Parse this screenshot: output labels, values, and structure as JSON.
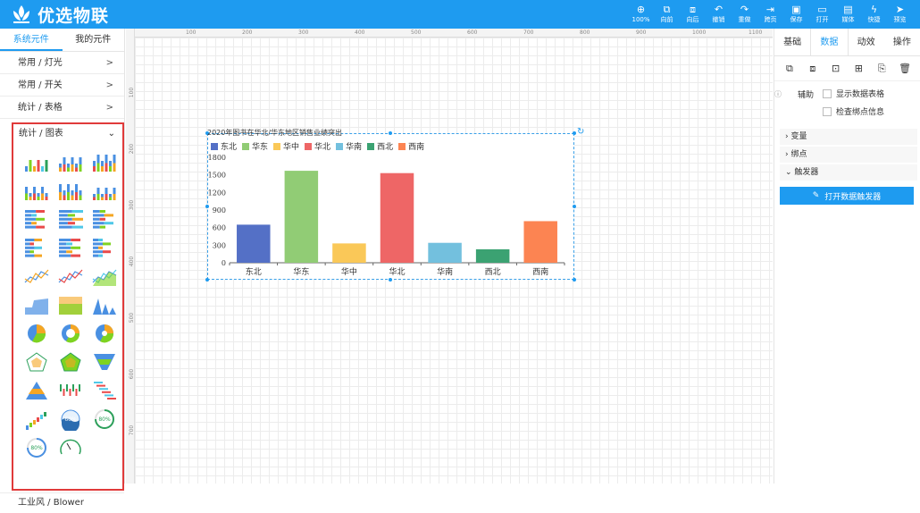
{
  "app": {
    "title": "优选物联"
  },
  "toolbar": {
    "items": [
      {
        "label": "100%",
        "icon": "zoom-icon"
      },
      {
        "label": "向前",
        "icon": "bring-forward-icon"
      },
      {
        "label": "向后",
        "icon": "send-backward-icon"
      },
      {
        "label": "撤销",
        "icon": "undo-icon"
      },
      {
        "label": "重做",
        "icon": "redo-icon"
      },
      {
        "label": "跨页",
        "icon": "cross-page-icon"
      },
      {
        "label": "保存",
        "icon": "save-icon"
      },
      {
        "label": "打开",
        "icon": "open-folder-icon"
      },
      {
        "label": "媒体",
        "icon": "media-icon"
      },
      {
        "label": "快捷",
        "icon": "lightning-icon"
      },
      {
        "label": "预览",
        "icon": "send-icon"
      }
    ]
  },
  "left": {
    "tabs": [
      {
        "label": "系统元件"
      },
      {
        "label": "我的元件"
      }
    ],
    "categories": [
      {
        "label": "常用 / 灯光"
      },
      {
        "label": "常用 / 开关"
      },
      {
        "label": "统计 / 表格"
      }
    ],
    "expanded": {
      "label": "统计 / 图表"
    },
    "gauge_labels": [
      "60%",
      "80%",
      "80%"
    ],
    "footer": {
      "label": "工业风 / Blower"
    }
  },
  "ruler": {
    "h_ticks": [
      "100",
      "200",
      "300",
      "400",
      "500",
      "600",
      "700",
      "800",
      "900",
      "1000",
      "1100"
    ],
    "v_ticks": [
      "100",
      "200",
      "300",
      "400",
      "500",
      "600",
      "700"
    ]
  },
  "chart_data": {
    "type": "bar",
    "title": "2020年图书在华北/华东地区销售业绩突出",
    "categories": [
      "东北",
      "华东",
      "华中",
      "华北",
      "华南",
      "西北",
      "西南"
    ],
    "values": [
      650,
      1570,
      330,
      1530,
      340,
      230,
      710
    ],
    "colors": [
      "#5470c6",
      "#91cc75",
      "#fac858",
      "#ee6666",
      "#73c0de",
      "#3ba272",
      "#fc8452"
    ],
    "legend": [
      "东北",
      "华东",
      "华中",
      "华北",
      "华南",
      "西北",
      "西南"
    ],
    "yticks": [
      "0",
      "300",
      "600",
      "900",
      "1200",
      "1500",
      "1800"
    ],
    "ylim": [
      0,
      1800
    ],
    "grid": false,
    "legend_position": "top-left"
  },
  "right": {
    "tabs": [
      {
        "label": "基础"
      },
      {
        "label": "数据"
      },
      {
        "label": "动效"
      },
      {
        "label": "操作"
      }
    ],
    "active_tab": "数据",
    "aux_label": "辅助",
    "options": [
      {
        "label": "显示数据表格"
      },
      {
        "label": "检查绑点信息"
      }
    ],
    "sections": [
      {
        "label": "变量"
      },
      {
        "label": "绑点"
      },
      {
        "label": "触发器"
      }
    ],
    "trigger_button": "打开数据触发器"
  }
}
